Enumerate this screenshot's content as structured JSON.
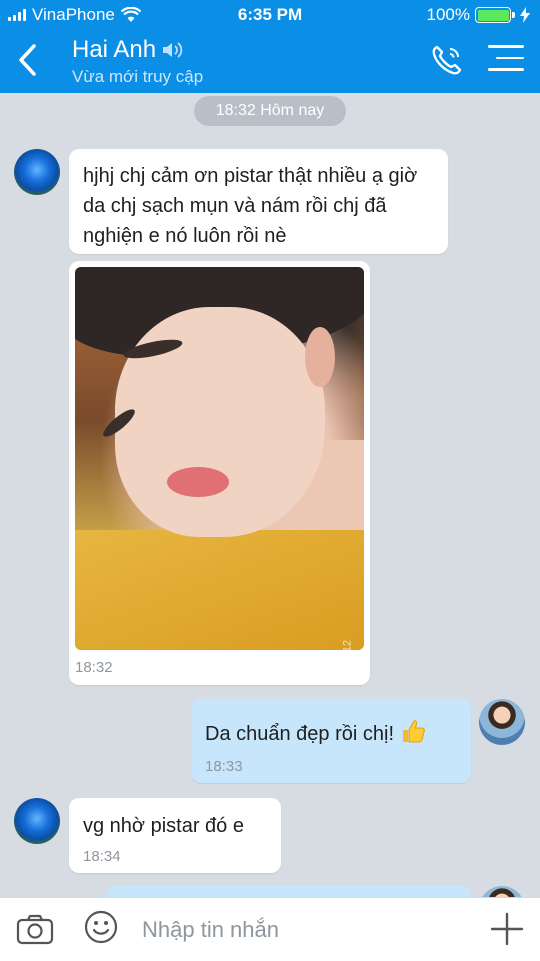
{
  "status_bar": {
    "carrier": "VinaPhone",
    "time": "6:35 PM",
    "battery": "100%"
  },
  "header": {
    "contact_name": "Hai Anh",
    "subtitle": "Vừa mới truy cập"
  },
  "date_divider": "18:32 Hôm nay",
  "messages": [
    {
      "from": "contact",
      "text": "hjhj chj cảm ơn pistar thật nhiều ạ giờ da chj sạch mụn và nám rồi chj đã nghiện e nó luôn rồi nè"
    },
    {
      "from": "contact",
      "type": "photo",
      "time": "18:32",
      "watermark": "B612"
    },
    {
      "from": "me",
      "text": "Da chuẩn đẹp rồi chị!",
      "time": "18:33"
    },
    {
      "from": "contact",
      "text": "vg nhờ pistar đó e",
      "time": "18:34"
    }
  ],
  "compose": {
    "placeholder": "Nhập tin nhắn"
  },
  "icons": {
    "back": "chevron-left-icon",
    "speaker": "speaker-icon",
    "call": "phone-icon",
    "menu": "menu-icon",
    "camera": "camera-icon",
    "emoji": "smiley-icon",
    "add": "plus-icon",
    "thumbs_up": "thumbs-up-icon"
  },
  "colors": {
    "header_bg": "#0a8ee6",
    "my_bubble": "#c7e6fb",
    "chat_bg": "#d7dce3"
  }
}
